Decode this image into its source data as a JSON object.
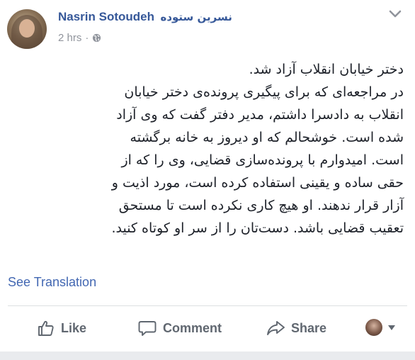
{
  "author": {
    "name": "Nasrin Sotoudeh",
    "name_fa": "نسرین ستوده",
    "time": "2 hrs",
    "separator": "·"
  },
  "post": {
    "lines": [
      "دختر خیابان انقلاب آزاد شد.",
      "در مراجعه‌ای که برای پیگیری پرونده‌ی دختر خیابان",
      "انقلاب به دادسرا داشتم، مدیر دفتر گفت که وی آزاد",
      "شده است. خوشحالم که او دیروز به خانه برگشته",
      "است. امیدوارم با پرونده‌سازی قضایی، وی را که از",
      "حقی ساده و یقینی استفاده کرده است، مورد اذیت و",
      "آزار قرار ندهند. او هیچ کاری نکرده است تا مستحق",
      "تعقیب قضایی باشد. دست‌تان را از سر او کوتاه کنید."
    ],
    "see_translation": "See Translation"
  },
  "actions": {
    "like": "Like",
    "comment": "Comment",
    "share": "Share"
  },
  "icons": {
    "privacy": "globe-icon",
    "options": "chevron-down-icon",
    "like": "thumbs-up-icon",
    "comment": "comment-bubble-icon",
    "share": "share-arrow-icon"
  },
  "colors": {
    "link": "#365899",
    "translation": "#4267b2",
    "meta": "#90949c",
    "action": "#606770"
  }
}
